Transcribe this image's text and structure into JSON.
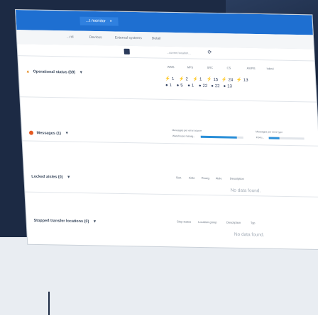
{
  "app": {
    "tab_label": "...t monitor",
    "close_glyph": "×"
  },
  "subnav": {
    "items": [
      "...rol",
      "Devices",
      "External systems",
      "Detail"
    ]
  },
  "toolbar": {
    "label": "...current location...",
    "glyph": "⟳"
  },
  "operational": {
    "title": "Operational status (69)",
    "columns": [
      "WMS",
      "MFS",
      "SRC",
      "CS",
      "AS/RS",
      "Inbnd"
    ],
    "vertical_heads": [
      "OK",
      "OK",
      "OK",
      "OK",
      "O",
      "OK"
    ],
    "row1": [
      "1",
      "2",
      "1",
      "15",
      "24",
      "13"
    ],
    "row2": [
      "1",
      "5",
      "1",
      "22",
      "22",
      "13"
    ]
  },
  "messages": {
    "title": "Messages (1)",
    "bar_label_1": "Messages per error source",
    "bar_label_1b": "Warehouse manag...",
    "bar_label_2": "Messages per error type",
    "bar_label_2b": "Inbou..."
  },
  "locked": {
    "title": "Locked aisles (0)",
    "columns": [
      "Stor.",
      "Aisle",
      "Reorg.",
      "Aisle",
      "Description"
    ],
    "empty": "No data found."
  },
  "stopped": {
    "title": "Stopped transfer locations (0)",
    "columns": [
      "Stop status",
      "Location group",
      "Description",
      "Typ"
    ],
    "empty": "No data found."
  }
}
